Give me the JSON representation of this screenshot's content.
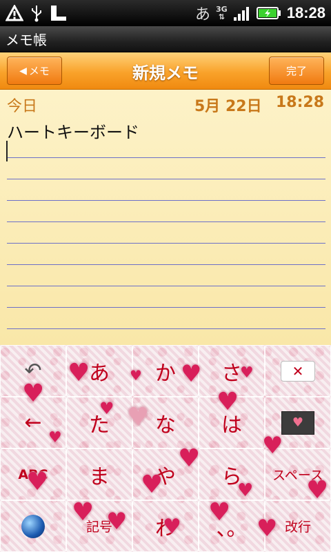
{
  "status_bar": {
    "icons_left": [
      "warning-icon",
      "usb-icon",
      "sd-card-icon"
    ],
    "ime": "あ",
    "network": "3G",
    "time": "18:28"
  },
  "app": {
    "title": "メモ帳"
  },
  "header": {
    "back_label": "メモ",
    "title": "新規メモ",
    "done_label": "完了"
  },
  "memo": {
    "day_label": "今日",
    "date": "5月 22日",
    "time": "18:28",
    "text": "ハートキーボード"
  },
  "keyboard": {
    "theme_colors": {
      "key_text": "#c0001c",
      "heart": "#d81f5a"
    },
    "rows": [
      [
        {
          "id": "undo",
          "label": "↶"
        },
        {
          "id": "a",
          "label": "あ"
        },
        {
          "id": "ka",
          "label": "か"
        },
        {
          "id": "sa",
          "label": "さ"
        },
        {
          "id": "backspace",
          "label": "✕"
        }
      ],
      [
        {
          "id": "left",
          "label": "←"
        },
        {
          "id": "ta",
          "label": "た"
        },
        {
          "id": "na",
          "label": "な"
        },
        {
          "id": "ha",
          "label": "は"
        },
        {
          "id": "right",
          "label": "♥"
        }
      ],
      [
        {
          "id": "abc",
          "label": "ABC"
        },
        {
          "id": "ma",
          "label": "ま"
        },
        {
          "id": "ya",
          "label": "や"
        },
        {
          "id": "ra",
          "label": "ら"
        },
        {
          "id": "space",
          "label": "スペース"
        }
      ],
      [
        {
          "id": "globe",
          "label": ""
        },
        {
          "id": "symbols",
          "label": "記号"
        },
        {
          "id": "wa",
          "label": "わ"
        },
        {
          "id": "punct",
          "label": "、。"
        },
        {
          "id": "enter",
          "label": "改行"
        }
      ]
    ]
  }
}
